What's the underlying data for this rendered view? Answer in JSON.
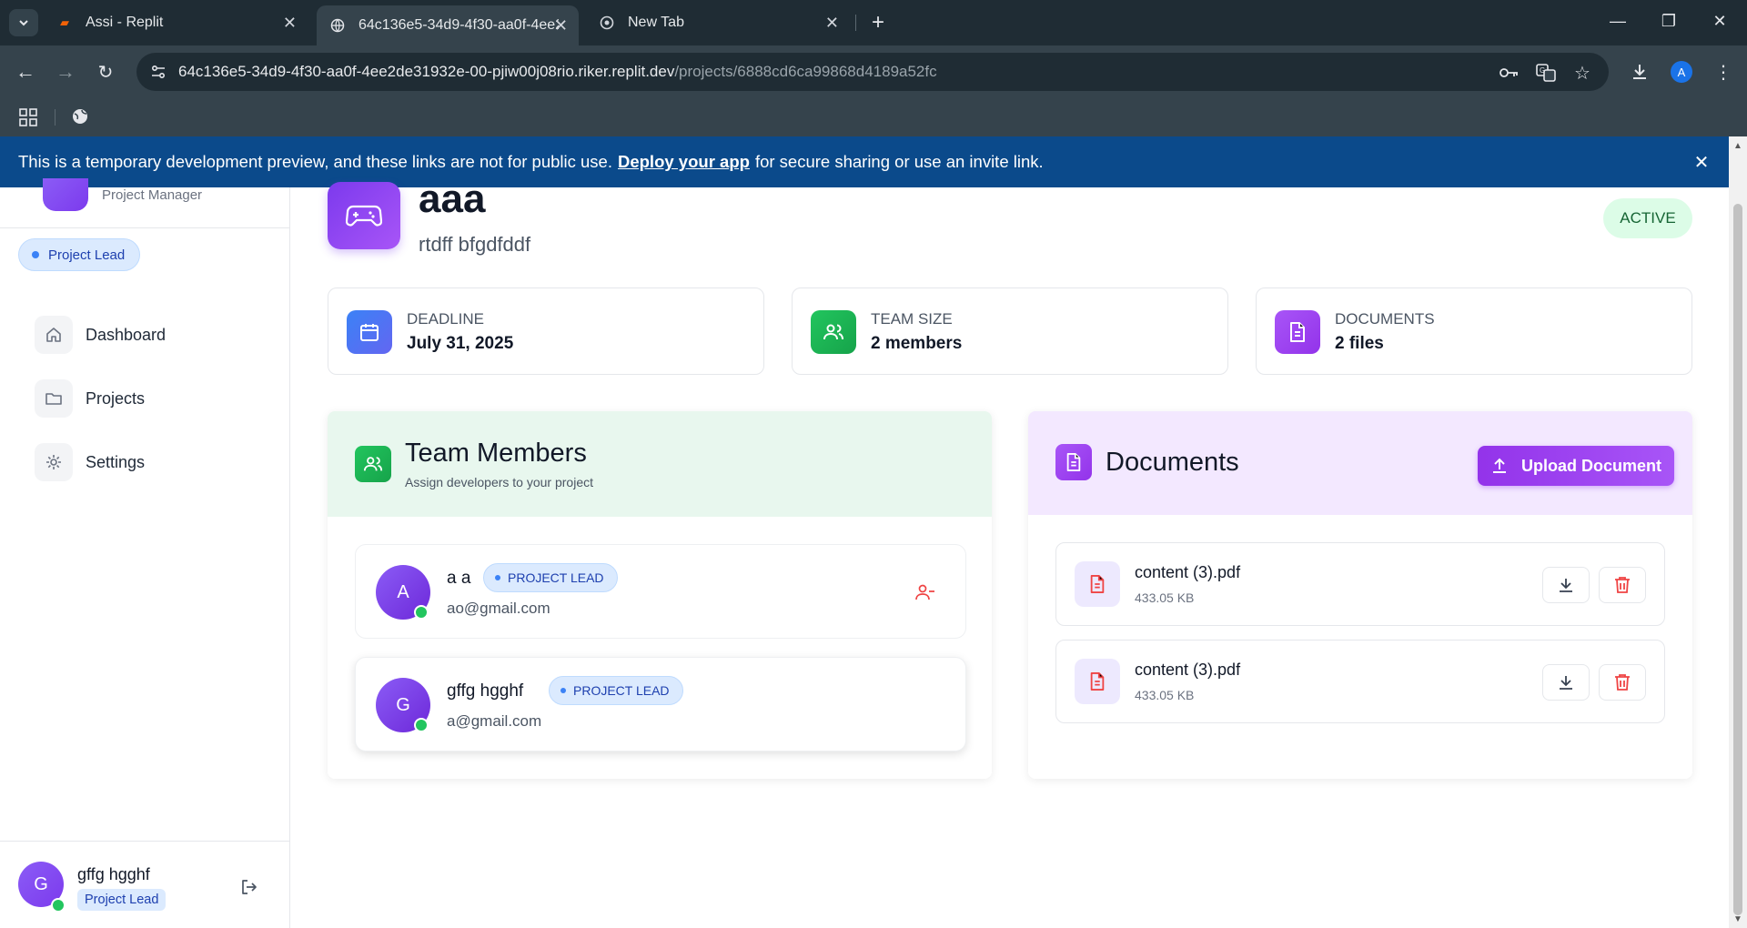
{
  "browser": {
    "tabs": [
      {
        "title": "Assi - Replit",
        "active": false
      },
      {
        "title": "64c136e5-34d9-4f30-aa0f-4ee2",
        "active": true
      },
      {
        "title": "New Tab",
        "active": false
      }
    ],
    "url_host": "64c136e5-34d9-4f30-aa0f-4ee2de31932e-00-pjiw00j08rio.riker.replit.dev",
    "url_path": "/projects/6888cd6ca99868d4189a52fc",
    "profile_initial": "A"
  },
  "banner": {
    "text_before": "This is a temporary development preview, and these links are not for public use.",
    "link": "Deploy your app",
    "text_after": "for secure sharing or use an invite link."
  },
  "sidebar": {
    "role_subtitle": "Project Manager",
    "role_chip": "Project Lead",
    "nav": [
      {
        "label": "Dashboard",
        "icon": "home-icon"
      },
      {
        "label": "Projects",
        "icon": "folder-icon"
      },
      {
        "label": "Settings",
        "icon": "gear-icon"
      }
    ],
    "user": {
      "initial": "G",
      "name": "gffg hgghf",
      "role": "Project Lead"
    }
  },
  "project": {
    "title": "aaa",
    "description": "rtdff bfgdfddf",
    "status": "ACTIVE",
    "stats": [
      {
        "label": "DEADLINE",
        "value": "July 31, 2025",
        "color": "#4f6ef7"
      },
      {
        "label": "TEAM SIZE",
        "value": "2 members",
        "color": "#22b35e"
      },
      {
        "label": "DOCUMENTS",
        "value": "2 files",
        "color": "#9b4ef5"
      }
    ]
  },
  "team": {
    "title": "Team Members",
    "subtitle": "Assign developers to your project",
    "members": [
      {
        "initial": "A",
        "name": "a a",
        "badge": "PROJECT LEAD",
        "email": "ao@gmail.com"
      },
      {
        "initial": "G",
        "name": "gffg hgghf",
        "badge": "PROJECT LEAD",
        "email": "a@gmail.com"
      }
    ]
  },
  "documents": {
    "title": "Documents",
    "upload_label": "Upload Document",
    "files": [
      {
        "name": "content (3).pdf",
        "size": "433.05 KB"
      },
      {
        "name": "content (3).pdf",
        "size": "433.05 KB"
      }
    ]
  },
  "colors": {
    "accent_purple": "#9333ea",
    "banner_blue": "#0b4a8b",
    "team_header_bg": "#e8f7ee",
    "docs_header_bg": "#f3e8ff"
  }
}
